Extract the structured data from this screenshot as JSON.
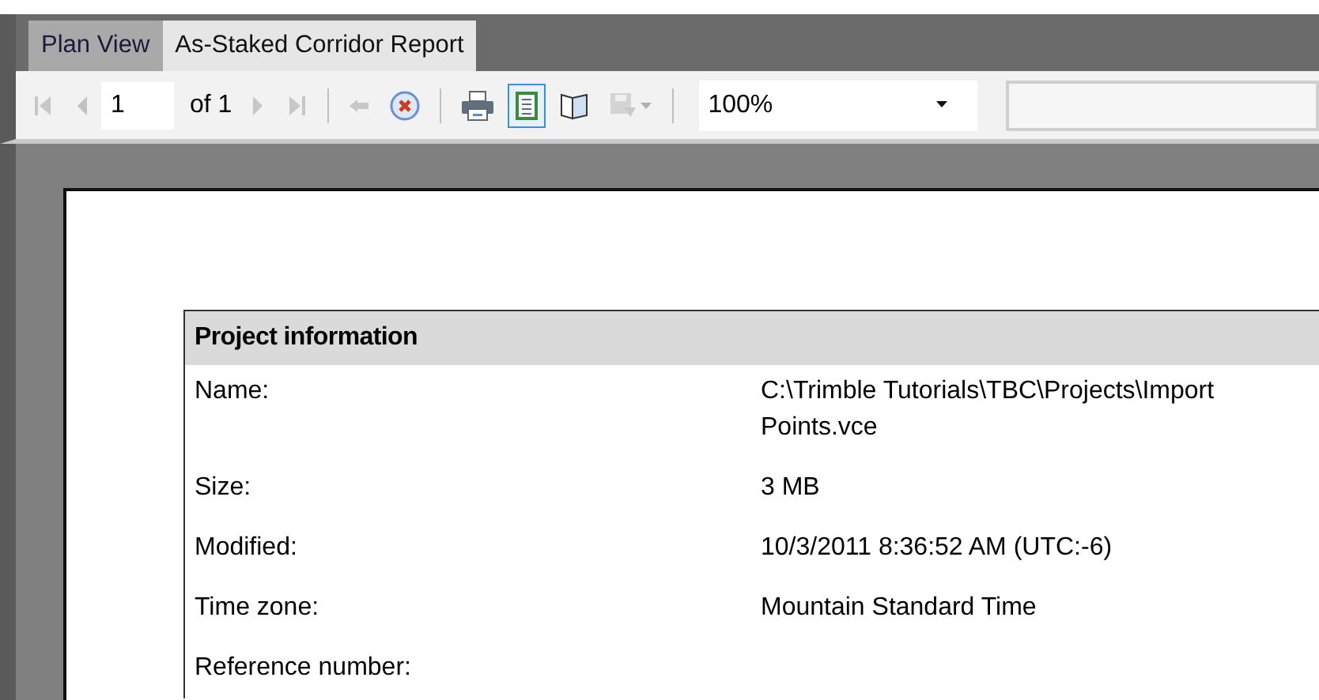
{
  "tabs": [
    {
      "label": "Plan View",
      "selected": false
    },
    {
      "label": "As-Staked Corridor Report",
      "selected": true
    }
  ],
  "toolbar": {
    "page_number": "1",
    "page_count": "of 1",
    "zoom": "100%",
    "buttons": [
      {
        "kind": "first",
        "disabled": true
      },
      {
        "kind": "prev",
        "disabled": true
      },
      {
        "kind": "pagefield"
      },
      {
        "kind": "next",
        "disabled": true
      },
      {
        "kind": "last",
        "disabled": true
      },
      {
        "kind": "sep"
      },
      {
        "kind": "back",
        "disabled": true
      },
      {
        "kind": "stop",
        "disabled": false
      },
      {
        "kind": "sep"
      },
      {
        "kind": "print",
        "disabled": false
      },
      {
        "kind": "layout",
        "disabled": false,
        "selected": true
      },
      {
        "kind": "setup",
        "disabled": false,
        "selected": false
      },
      {
        "kind": "export",
        "disabled": true
      },
      {
        "kind": "sep"
      }
    ]
  },
  "report": {
    "section_title": "Project information",
    "rows": [
      {
        "label": "Name:",
        "value": "C:\\Trimble Tutorials\\TBC\\Projects\\Import\nPoints.vce"
      },
      {
        "label": "Size:",
        "value": "3 MB"
      },
      {
        "label": "Modified:",
        "value": "10/3/2011 8:36:52 AM (UTC:-6)"
      },
      {
        "label": "Time zone:",
        "value": "Mountain Standard Time"
      },
      {
        "label": "Reference number:",
        "value": ""
      }
    ]
  }
}
